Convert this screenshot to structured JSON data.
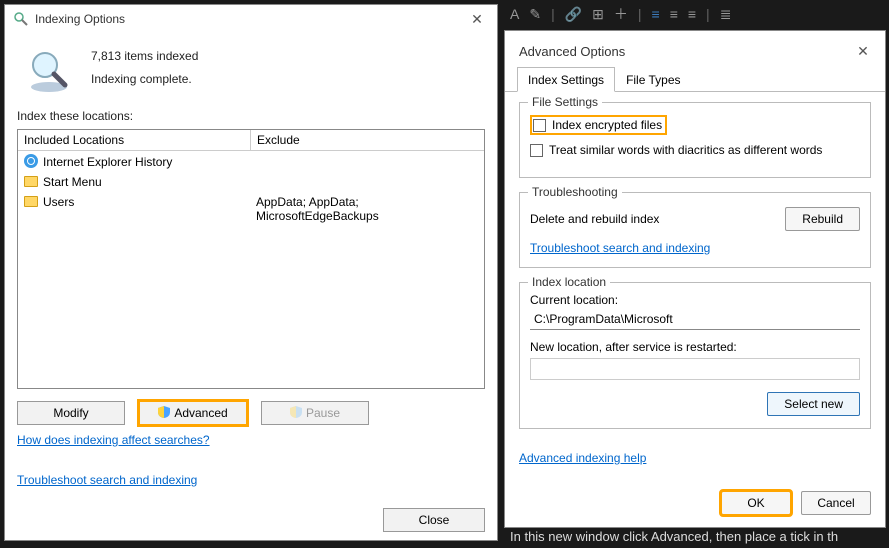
{
  "indexing": {
    "title": "Indexing Options",
    "items_indexed": "7,813 items indexed",
    "status": "Indexing complete.",
    "label_locations": "Index these locations:",
    "col_included": "Included Locations",
    "col_exclude": "Exclude",
    "rows": [
      {
        "name": "Internet Explorer History",
        "exclude": "",
        "icon": "ie"
      },
      {
        "name": "Start Menu",
        "exclude": "",
        "icon": "folder"
      },
      {
        "name": "Users",
        "exclude": "AppData; AppData; MicrosoftEdgeBackups",
        "icon": "folder"
      }
    ],
    "btn_modify": "Modify",
    "btn_advanced": "Advanced",
    "btn_pause": "Pause",
    "link_searches": "How does indexing affect searches?",
    "link_troubleshoot": "Troubleshoot search and indexing",
    "btn_close": "Close"
  },
  "advanced": {
    "title": "Advanced Options",
    "tabs": {
      "index": "Index Settings",
      "filetypes": "File Types"
    },
    "group_file": "File Settings",
    "chk_encrypted": "Index encrypted files",
    "chk_diacritics": "Treat similar words with diacritics as different words",
    "group_trouble": "Troubleshooting",
    "delete_rebuild": "Delete and rebuild index",
    "btn_rebuild": "Rebuild",
    "link_troubleshoot": "Troubleshoot search and indexing",
    "group_location": "Index location",
    "current_loc_label": "Current location:",
    "current_loc": "C:\\ProgramData\\Microsoft",
    "new_loc_label": "New location, after service is restarted:",
    "btn_selectnew": "Select new",
    "link_help": "Advanced indexing help",
    "btn_ok": "OK",
    "btn_cancel": "Cancel"
  },
  "bg": {
    "text": "In this new window click Advanced, then place a tick in th"
  }
}
